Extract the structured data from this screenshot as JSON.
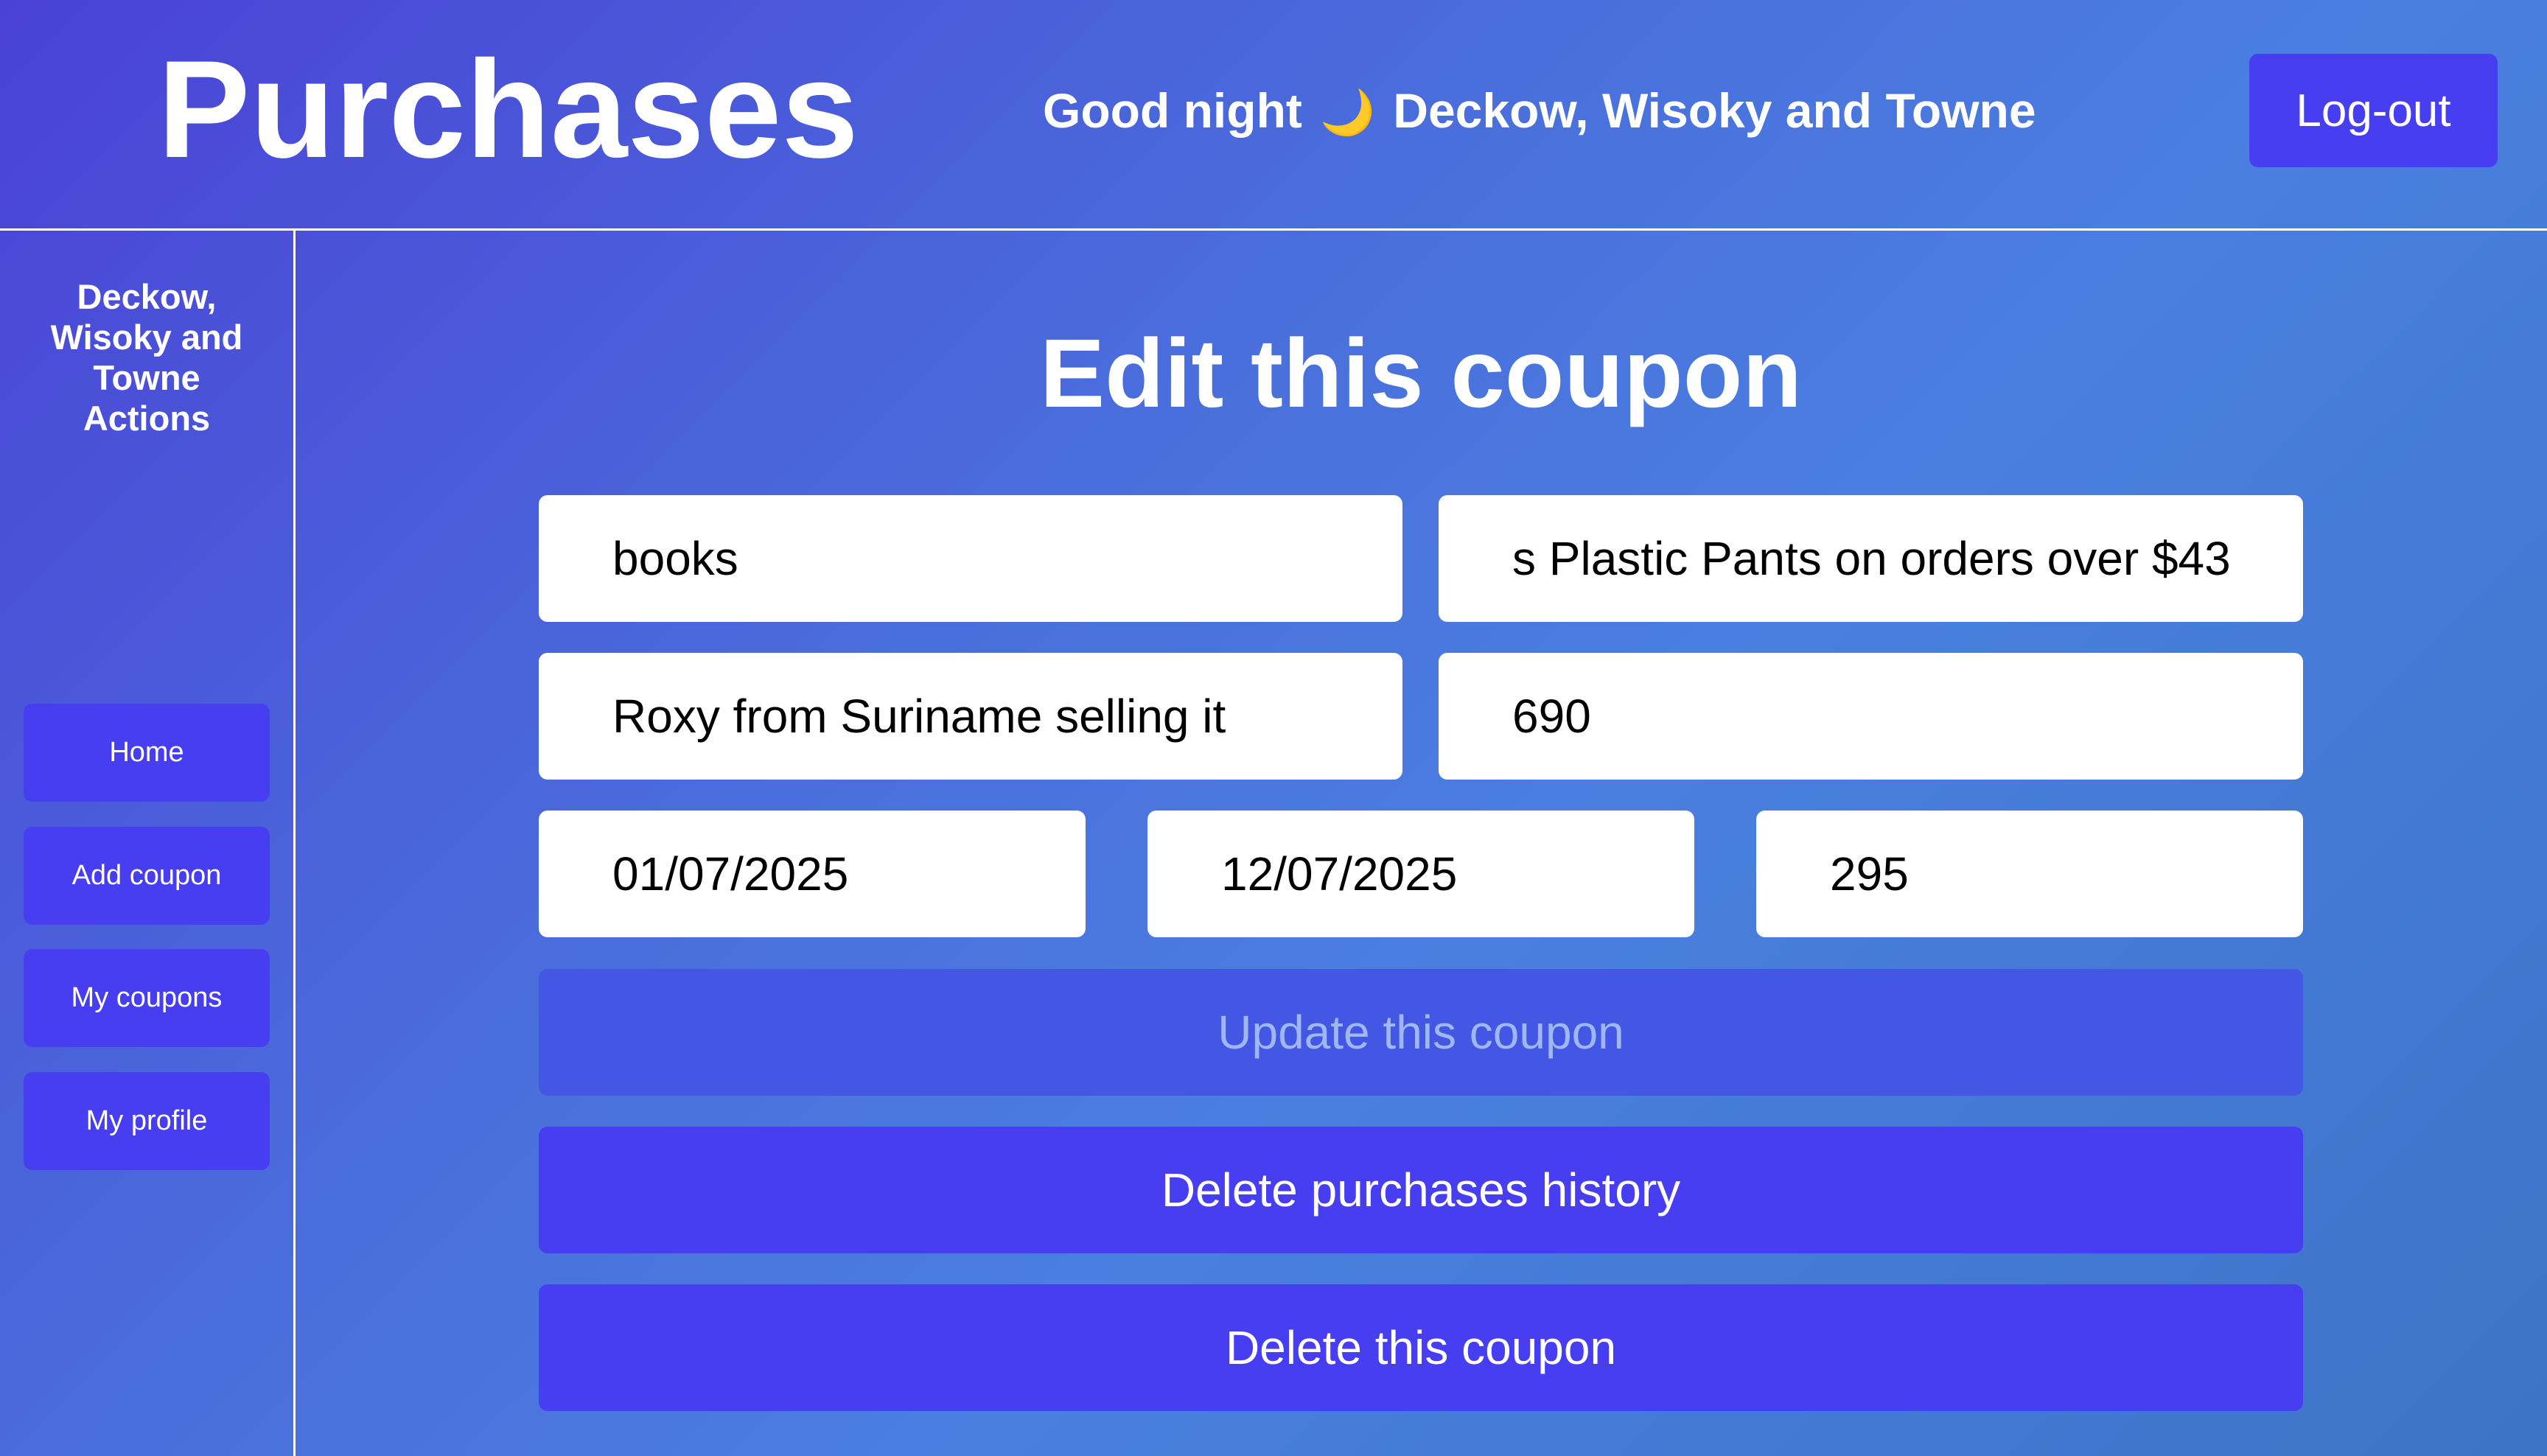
{
  "header": {
    "app_title": "Purchases",
    "greeting_prefix": "Good night",
    "greeting_icon": "🌙",
    "company_name": "Deckow, Wisoky and Towne",
    "logout_label": "Log-out"
  },
  "sidebar": {
    "title_lines": [
      "Deckow,",
      "Wisoky and",
      "Towne",
      "Actions"
    ],
    "items": [
      {
        "label": "Home"
      },
      {
        "label": "Add coupon"
      },
      {
        "label": "My coupons"
      },
      {
        "label": "My profile"
      }
    ]
  },
  "form": {
    "title": "Edit this coupon",
    "category": "books",
    "description": "s Plastic Pants on orders over $43",
    "title_field": "Roxy from Suriname selling it",
    "amount": "690",
    "start_date": "01/07/2025",
    "end_date": "12/07/2025",
    "price": "295",
    "update_label": "Update this coupon",
    "delete_history_label": "Delete purchases history",
    "delete_coupon_label": "Delete this coupon"
  },
  "colors": {
    "accent": "#463ef0",
    "background_gradient": [
      "#4a42d6",
      "#4a7fe0",
      "#3d74c6"
    ],
    "moon": "#f2cc4a",
    "disabled_text": "#9fb7f4"
  }
}
